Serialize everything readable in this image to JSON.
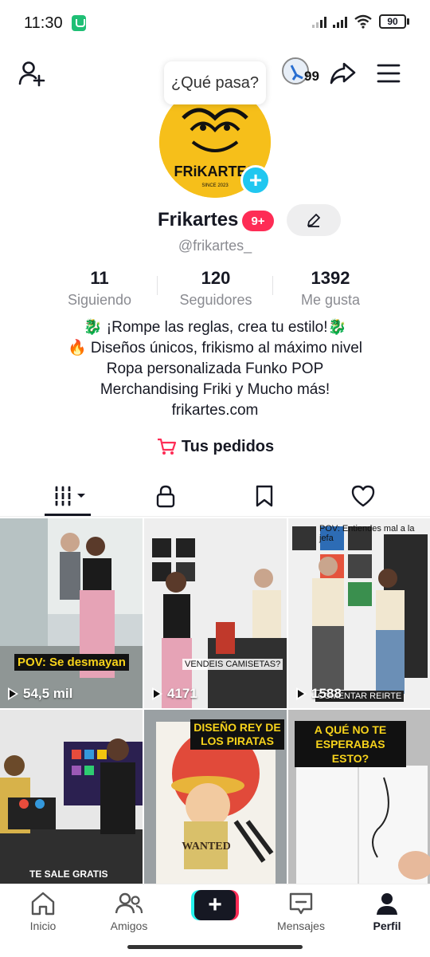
{
  "status_bar": {
    "time": "11:30",
    "battery": "90"
  },
  "header": {
    "tooltip": "¿Qué pasa?",
    "history_count": "99"
  },
  "profile": {
    "display_name": "Frikartes",
    "notification_badge": "9+",
    "username": "@frikartes_",
    "avatar_brand": "FRiKARTES",
    "avatar_since": "SINCE 2023"
  },
  "stats": [
    {
      "value": "11",
      "label": "Siguiendo"
    },
    {
      "value": "120",
      "label": "Seguidores"
    },
    {
      "value": "1392",
      "label": "Me gusta"
    }
  ],
  "bio": {
    "line1": "🐉 ¡Rompe las reglas, crea tu estilo!🐉",
    "line2": "🔥 Diseños únicos, frikismo al máximo nivel",
    "line3": "Ropa personalizada Funko POP",
    "line4": "Merchandising Friki y Mucho más!",
    "line5": "frikartes.com"
  },
  "orders_label": "Tus pedidos",
  "tabs": [
    {
      "icon": "grid-icon",
      "active": true
    },
    {
      "icon": "lock-icon"
    },
    {
      "icon": "bookmark-icon"
    },
    {
      "icon": "heart-icon"
    }
  ],
  "videos": [
    {
      "views": "54,5 mil",
      "caption": "POV: Se desmayan"
    },
    {
      "views": "4171",
      "caption": "VENDEIS CAMISETAS?"
    },
    {
      "views": "1588",
      "caption": "POV: Entiendes mal a la jefa",
      "caption2": "COMENTAR REIRTE"
    },
    {
      "views": "",
      "caption": "TE SALE GRATIS"
    },
    {
      "views": "",
      "caption": "DISEÑO REY DE LOS PIRATAS"
    },
    {
      "views": "",
      "caption": "A QUÉ NO TE ESPERABAS ESTO?"
    }
  ],
  "bottom_nav": {
    "home": "Inicio",
    "friends": "Amigos",
    "messages": "Mensajes",
    "profile": "Perfil"
  },
  "colors": {
    "accent": "#fe2c55",
    "cyan": "#25f4ee",
    "avatar_bg": "#f6bf1a",
    "plus": "#20c7f0"
  }
}
